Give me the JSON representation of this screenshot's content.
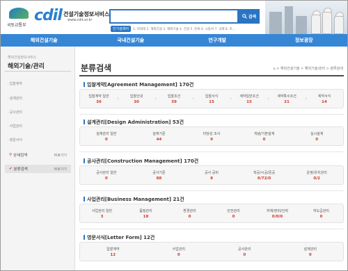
{
  "header": {
    "gov_logo_text": "국토교통부",
    "brand": "cdil",
    "site_name": "건설기술정보서비스",
    "site_url": "www.cdit.or.kr",
    "search_button": "검색",
    "popular_label": "인기검색어",
    "popular_terms": "1. 야외데 2. 해외건설 3. 해외기술 4. 건설 5. 분류 6. 시방서 7. 국제 8. 조..."
  },
  "nav": {
    "items": [
      "해외건설기술",
      "국내건설기술",
      "연구개발",
      "정보광장"
    ]
  },
  "sidebar": {
    "subtitle": "해외건설정보서비스",
    "title": "해외기술/관리",
    "menu": [
      "입찰계약",
      "설계관리",
      "공사관리",
      "사업관리",
      "영문서식"
    ],
    "sub_items": [
      {
        "label": "상세검색",
        "shortcut": "바로가기"
      },
      {
        "label": "분류검색",
        "shortcut": "바로가기",
        "active": true
      }
    ]
  },
  "main": {
    "title": "분류검색",
    "breadcrumb": "⌂ > 해외건설기술 > 해외기술/관리 > 분류검색",
    "sections": [
      {
        "title": "입찰계약[Agreement Management] 170건",
        "items": [
          {
            "name": "입찰계약 일반",
            "count": "36"
          },
          {
            "name": "입찰안내",
            "count": "30"
          },
          {
            "name": "입찰조건",
            "count": "39"
          },
          {
            "name": "입찰서식",
            "count": "15"
          },
          {
            "name": "계약일반조건",
            "count": "15"
          },
          {
            "name": "계약특수조건",
            "count": "21"
          },
          {
            "name": "계약서식",
            "count": "14"
          }
        ]
      },
      {
        "title": "설계관리[Design Administration] 53건",
        "items": [
          {
            "name": "설계관리 일반",
            "count": "0"
          },
          {
            "name": "설계기준",
            "count": "44"
          },
          {
            "name": "타당성 조사",
            "count": "9"
          },
          {
            "name": "개념/기본설계",
            "count": "0"
          },
          {
            "name": "실시설계",
            "count": "0"
          }
        ]
      },
      {
        "title": "공사관리[Construction Management] 170건",
        "items": [
          {
            "name": "공사관리 일반",
            "count": "0"
          },
          {
            "name": "공사기준",
            "count": "88"
          },
          {
            "name": "공사 공비",
            "count": "8"
          },
          {
            "name": "착공/시공/준공",
            "count": "0/72/0"
          },
          {
            "name": "운영/유지관리",
            "count": "0/2"
          }
        ]
      },
      {
        "title": "사업관리[Business Management] 21건",
        "items": [
          {
            "name": "사업관리 일반",
            "count": "3"
          },
          {
            "name": "품질관리",
            "count": "18"
          },
          {
            "name": "환경관리",
            "count": "0"
          },
          {
            "name": "안전관리",
            "count": "0"
          },
          {
            "name": "자재/장비/인력",
            "count": "0/0/0"
          },
          {
            "name": "하도급관리",
            "count": "0"
          }
        ]
      },
      {
        "title": "영문서식[Letter Form] 12건",
        "items": [
          {
            "name": "입찰계약",
            "count": "12"
          },
          {
            "name": "사업관리",
            "count": "0"
          },
          {
            "name": "공사관리",
            "count": "0"
          },
          {
            "name": "설계관리",
            "count": "0"
          }
        ]
      }
    ]
  },
  "colors": {
    "accent": "#3686d6",
    "count": "#d03a2a"
  }
}
